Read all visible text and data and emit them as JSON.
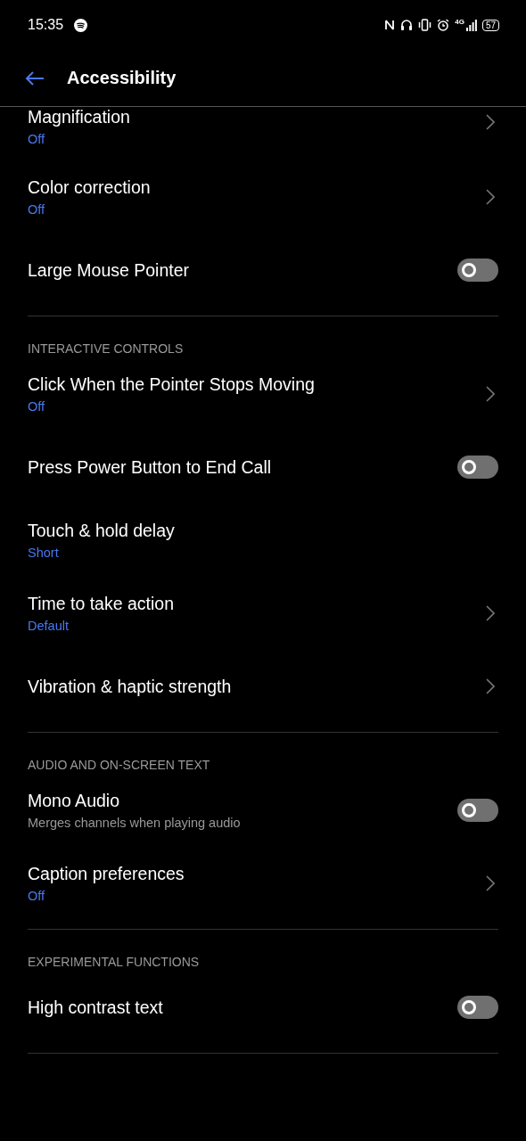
{
  "status_bar": {
    "time": "15:35",
    "network": "4G",
    "battery": "57"
  },
  "header": {
    "title": "Accessibility"
  },
  "sections": [
    {
      "items": [
        {
          "kind": "link",
          "title": "Magnification",
          "value": "Off"
        },
        {
          "kind": "link",
          "title": "Color correction",
          "value": "Off"
        },
        {
          "kind": "toggle",
          "title": "Large Mouse Pointer",
          "on": false
        }
      ]
    },
    {
      "heading": "INTERACTIVE CONTROLS",
      "items": [
        {
          "kind": "link",
          "title": "Click When the Pointer Stops Moving",
          "value": "Off"
        },
        {
          "kind": "toggle",
          "title": "Press Power Button to End Call",
          "on": false
        },
        {
          "kind": "plain",
          "title": "Touch & hold delay",
          "value": "Short"
        },
        {
          "kind": "link",
          "title": "Time to take action",
          "value": "Default"
        },
        {
          "kind": "link",
          "title": "Vibration & haptic strength"
        }
      ]
    },
    {
      "heading": "AUDIO AND ON-SCREEN TEXT",
      "items": [
        {
          "kind": "toggle",
          "title": "Mono Audio",
          "description": "Merges channels when playing audio",
          "on": false
        },
        {
          "kind": "link",
          "title": "Caption preferences",
          "value": "Off"
        }
      ]
    },
    {
      "heading": "EXPERIMENTAL FUNCTIONS",
      "items": [
        {
          "kind": "toggle",
          "title": "High contrast text",
          "on": false
        }
      ]
    }
  ]
}
